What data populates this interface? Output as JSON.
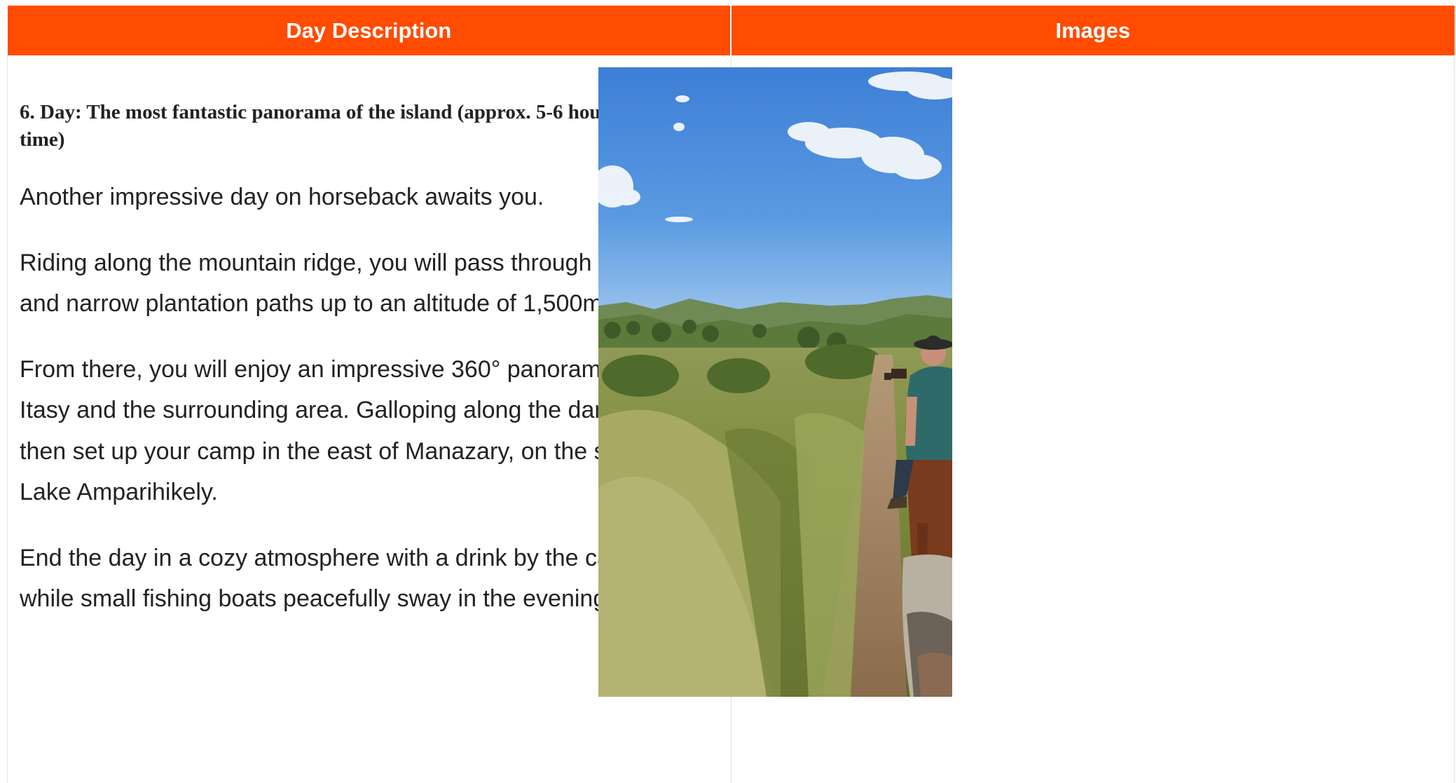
{
  "table": {
    "headers": {
      "day_description": "Day Description",
      "images": "Images"
    },
    "day": {
      "title": "6. Day: The most fantastic panorama of the island (approx. 5-6 hours riding time)",
      "paragraphs": [
        "Another impressive day on horseback awaits you.",
        "Riding along the mountain ridge, you will pass through rice fields and narrow plantation paths up to an altitude of 1,500m.",
        "From there, you will enjoy an impressive 360° panorama of Lake Itasy and the surrounding area. Galloping along the dam, you will then set up your camp in the east of Manazary, on the shore of Lake Amparihikely.",
        "End the day in a cozy atmosphere with a drink by the campfire, while small fishing boats peacefully sway in the evening sun."
      ]
    }
  },
  "colors": {
    "header_bg": "#ff4c00",
    "header_text": "#ffffff",
    "body_text": "#222222",
    "border": "#e4e4e4"
  }
}
